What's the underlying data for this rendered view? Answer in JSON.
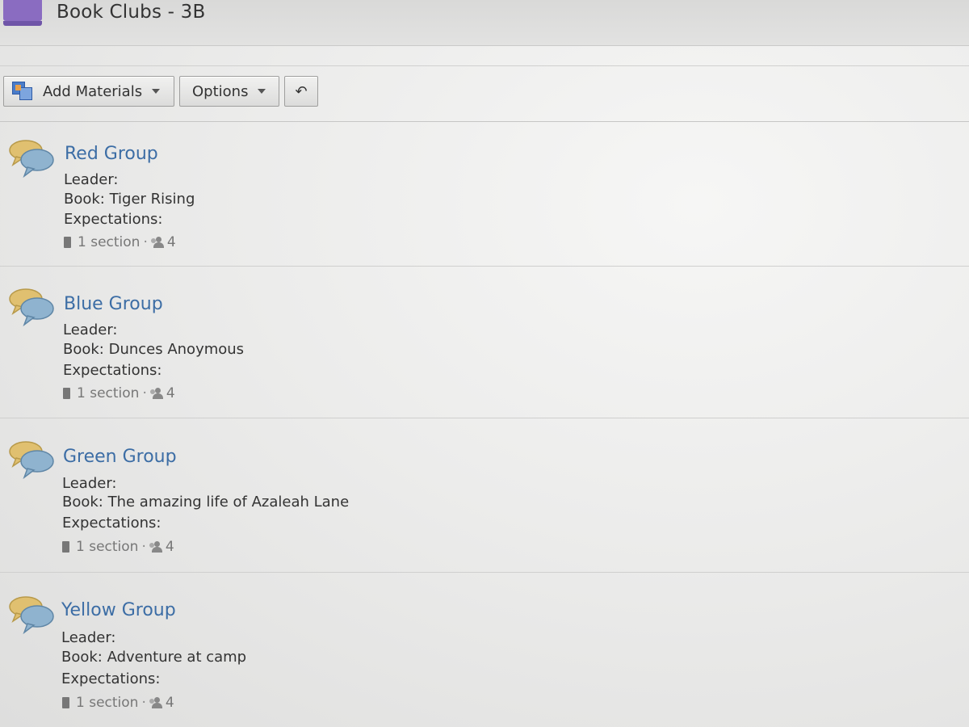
{
  "header": {
    "title": "Book Clubs - 3B"
  },
  "toolbar": {
    "add_materials_label": "Add Materials",
    "options_label": "Options",
    "undo_glyph": "↶"
  },
  "groups": [
    {
      "name": "Red Group",
      "leader": "Leader:",
      "book": "Book: Tiger Rising",
      "expectations": "Expectations:",
      "sections": "1 section",
      "separator": "·",
      "members": "4"
    },
    {
      "name": "Blue Group",
      "leader": "Leader:",
      "book": "Book: Dunces Anoymous",
      "expectations": "Expectations:",
      "sections": "1 section",
      "separator": "·",
      "members": "4"
    },
    {
      "name": "Green Group",
      "leader": "Leader:",
      "book": "Book: The amazing life of Azaleah Lane",
      "expectations": "Expectations:",
      "sections": "1 section",
      "separator": "·",
      "members": "4"
    },
    {
      "name": "Yellow Group",
      "leader": "Leader:",
      "book": "Book: Adventure at camp",
      "expectations": "Expectations:",
      "sections": "1 section",
      "separator": "·",
      "members": "4"
    }
  ],
  "icons": {
    "folder": "folder-icon",
    "add_materials": "add-materials-icon",
    "dropdown": "chevron-down-icon",
    "undo": "undo-icon",
    "discussion": "discussion-bubbles-icon",
    "section": "book-icon",
    "members": "people-icon"
  },
  "colors": {
    "group_link": "#3c6da5",
    "folder": "#8a6cc1",
    "bubble_back": "#e0c070",
    "bubble_front": "#8fb3cf"
  }
}
